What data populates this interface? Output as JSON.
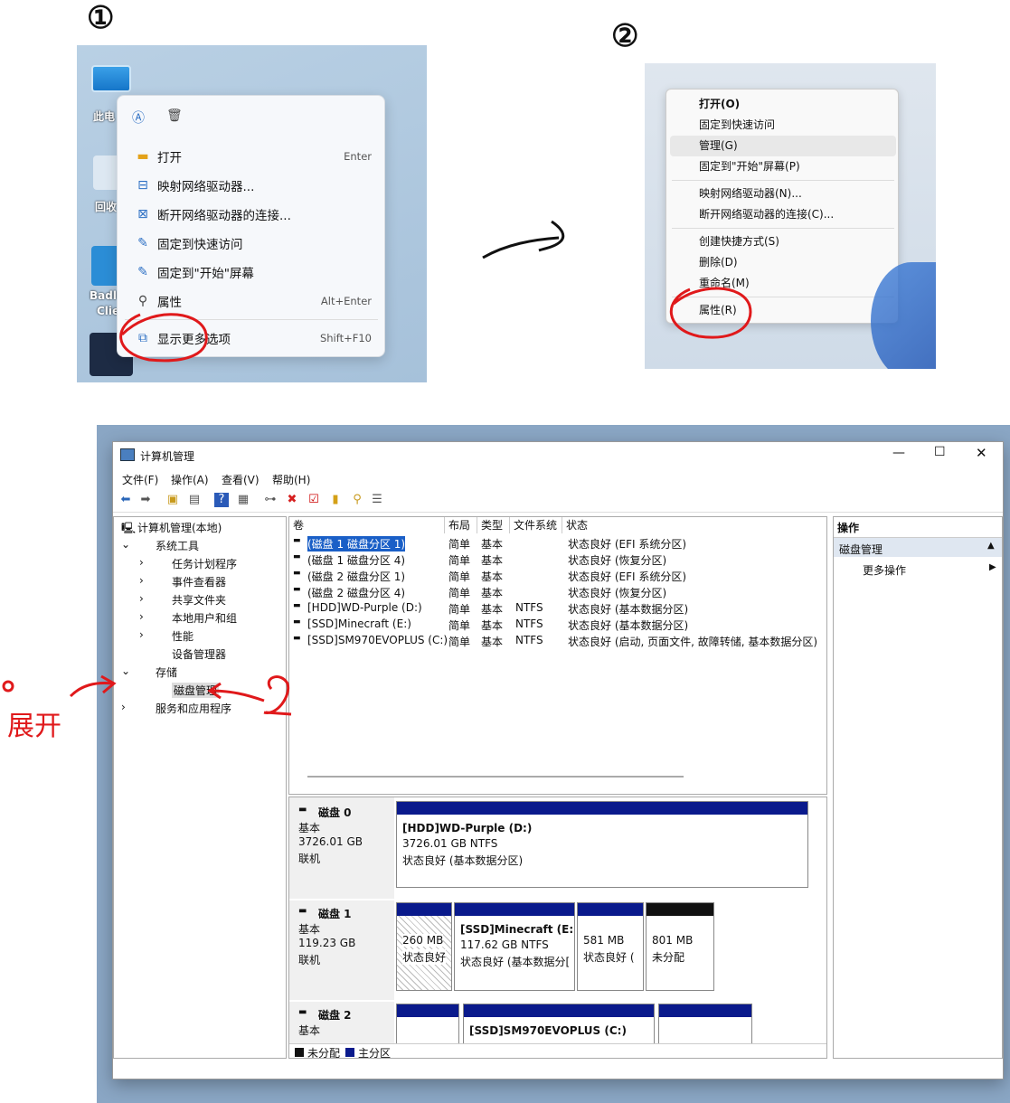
{
  "steps": {
    "one": "①",
    "two": "②"
  },
  "panel1": {
    "desktop_labels": [
      "此电",
      "回收",
      "Badli",
      "Clie"
    ],
    "toolbar_icons": [
      "rename-icon",
      "delete-icon"
    ],
    "items": [
      {
        "label": "打开",
        "shortcut": "Enter",
        "icon": "folder-icon"
      },
      {
        "label": "映射网络驱动器...",
        "shortcut": "",
        "icon": "network-drive-icon"
      },
      {
        "label": "断开网络驱动器的连接...",
        "shortcut": "",
        "icon": "disconnect-drive-icon"
      },
      {
        "label": "固定到快速访问",
        "shortcut": "",
        "icon": "pin-icon"
      },
      {
        "label": "固定到\"开始\"屏幕",
        "shortcut": "",
        "icon": "pin-icon"
      },
      {
        "label": "属性",
        "shortcut": "Alt+Enter",
        "icon": "wrench-icon"
      },
      {
        "label": "显示更多选项",
        "shortcut": "Shift+F10",
        "icon": "more-options-icon"
      }
    ]
  },
  "panel2": {
    "items": [
      "打开(O)",
      "固定到快速访问",
      "管理(G)",
      "固定到\"开始\"屏幕(P)",
      "映射网络驱动器(N)...",
      "断开网络驱动器的连接(C)...",
      "创建快捷方式(S)",
      "删除(D)",
      "重命名(M)",
      "属性(R)"
    ]
  },
  "window": {
    "title": "计算机管理",
    "menus": [
      "文件(F)",
      "操作(A)",
      "查看(V)",
      "帮助(H)"
    ],
    "tree": [
      {
        "label": "计算机管理(本地)"
      },
      {
        "label": "系统工具"
      },
      {
        "label": "任务计划程序"
      },
      {
        "label": "事件查看器"
      },
      {
        "label": "共享文件夹"
      },
      {
        "label": "本地用户和组"
      },
      {
        "label": "性能"
      },
      {
        "label": "设备管理器"
      },
      {
        "label": "存储"
      },
      {
        "label": "磁盘管理"
      },
      {
        "label": "服务和应用程序"
      }
    ],
    "columns": [
      "卷",
      "布局",
      "类型",
      "文件系统",
      "状态"
    ],
    "volumes": [
      {
        "name": "(磁盘 1 磁盘分区 1)",
        "layout": "简单",
        "type": "基本",
        "fs": "",
        "status": "状态良好 (EFI 系统分区)"
      },
      {
        "name": "(磁盘 1 磁盘分区 4)",
        "layout": "简单",
        "type": "基本",
        "fs": "",
        "status": "状态良好 (恢复分区)"
      },
      {
        "name": "(磁盘 2 磁盘分区 1)",
        "layout": "简单",
        "type": "基本",
        "fs": "",
        "status": "状态良好 (EFI 系统分区)"
      },
      {
        "name": "(磁盘 2 磁盘分区 4)",
        "layout": "简单",
        "type": "基本",
        "fs": "",
        "status": "状态良好 (恢复分区)"
      },
      {
        "name": "[HDD]WD-Purple (D:)",
        "layout": "简单",
        "type": "基本",
        "fs": "NTFS",
        "status": "状态良好 (基本数据分区)"
      },
      {
        "name": "[SSD]Minecraft (E:)",
        "layout": "简单",
        "type": "基本",
        "fs": "NTFS",
        "status": "状态良好 (基本数据分区)"
      },
      {
        "name": "[SSD]SM970EVOPLUS (C:)",
        "layout": "简单",
        "type": "基本",
        "fs": "NTFS",
        "status": "状态良好 (启动, 页面文件, 故障转储, 基本数据分区)"
      }
    ],
    "disk0": {
      "name": "磁盘 0",
      "kind": "基本",
      "size": "3726.01 GB",
      "state": "联机",
      "p1_name": "[HDD]WD-Purple  (D:)",
      "p1_size": "3726.01 GB NTFS",
      "p1_status": "状态良好 (基本数据分区)"
    },
    "disk1": {
      "name": "磁盘 1",
      "kind": "基本",
      "size": "119.23 GB",
      "state": "联机",
      "p1_size": "260 MB",
      "p1_status": "状态良好",
      "p2_name": "[SSD]Minecraft  (E:)",
      "p2_size": "117.62 GB NTFS",
      "p2_status": "状态良好 (基本数据分[",
      "p3_size": "581 MB",
      "p3_status": "状态良好 (",
      "p4_size": "801 MB",
      "p4_status": "未分配"
    },
    "disk2": {
      "name": "磁盘 2",
      "kind": "基本",
      "p2_name": "[SSD]SM970EVOPLUS  (C:)"
    },
    "legend": {
      "unalloc": "未分配",
      "primary": "主分区"
    },
    "actions": {
      "header": "操作",
      "section": "磁盘管理",
      "more": "更多操作"
    }
  },
  "annotations": {
    "expand": "展开",
    "two": "②"
  },
  "colors": {
    "partition_bar": "#0a1a8c",
    "unallocated_bar": "#111111",
    "annotation": "#e0191b"
  }
}
